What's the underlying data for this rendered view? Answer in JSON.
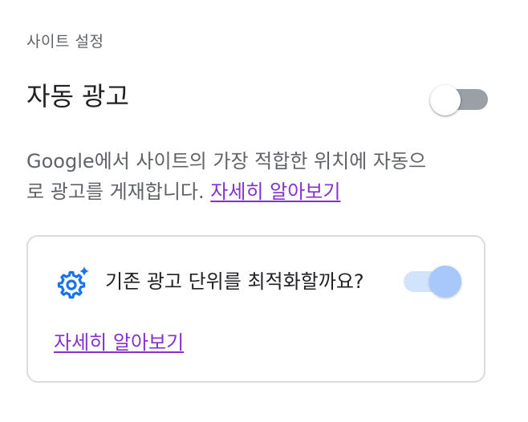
{
  "header": {
    "section_label": "사이트 설정"
  },
  "auto_ads": {
    "title": "자동 광고",
    "enabled": false,
    "description": "Google에서 사이트의 가장 적합한 위치에 자동으로 광고를 게재합니다. ",
    "learn_more_label": "자세히 알아보기"
  },
  "optimize_card": {
    "icon": "settings-sparkle-icon",
    "question": "기존 광고 단위를 최적화할까요?",
    "enabled": true,
    "learn_more_label": "자세히 알아보기"
  },
  "colors": {
    "link": "#8430ce",
    "icon_blue": "#1a73e8",
    "toggle_on_track": "#d2e3fc",
    "toggle_on_thumb": "#a8c7fa",
    "toggle_off_track": "#9aa0a6"
  }
}
